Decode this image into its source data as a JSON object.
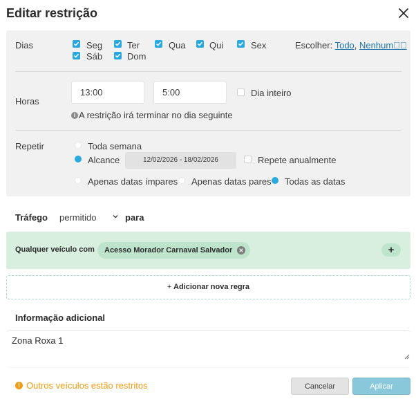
{
  "dialog": {
    "title": "Editar restrição",
    "close_icon": "close-icon"
  },
  "days": {
    "label": "Dias",
    "items": [
      {
        "label": "Seg",
        "checked": true
      },
      {
        "label": "Ter",
        "checked": true
      },
      {
        "label": "Qua",
        "checked": true
      },
      {
        "label": "Qui",
        "checked": true
      },
      {
        "label": "Sex",
        "checked": true
      },
      {
        "label": "Sáb",
        "checked": true
      },
      {
        "label": "Dom",
        "checked": true
      }
    ],
    "choose_label": "Escolher:",
    "choose_all": "Todo",
    "choose_sep": ",",
    "choose_none": "Nenhum",
    "choose_trailing": "⃞⃞"
  },
  "hours": {
    "label": "Horas",
    "start": "13:00",
    "end": "5:00",
    "all_day_label": "Dia inteiro",
    "all_day_checked": false,
    "info_icon": "info-icon",
    "info_text": "A restrição irá terminar no dia seguinte"
  },
  "repeat": {
    "label": "Repetir",
    "options": {
      "whole_week": "Toda semana",
      "range": "Alcance"
    },
    "selected": "Alcance",
    "date_range": "12/02/2026 - 18/02/2026",
    "annually_label": "Repete anualmente",
    "annually_checked": false,
    "date_filter": {
      "odd": "Apenas datas ímpares",
      "even": "Apenas datas pares",
      "all": "Todas as datas",
      "selected": "Todas as datas"
    }
  },
  "traffic": {
    "label": "Tráfego",
    "value": "permitido",
    "para": "para"
  },
  "rule": {
    "label": "Qualquer veículo com",
    "chip": "Acesso Morador Carnaval Salvador",
    "add_icon": "+"
  },
  "add_rule": {
    "plus": "+",
    "label": "Adicionar nova regra"
  },
  "additional_info": {
    "title": "Informação adicional",
    "value": "Zona Roxa 1"
  },
  "footer": {
    "warning_icon": "!",
    "warning": "Outros veículos estão restritos",
    "cancel": "Cancelar",
    "apply": "Aplicar"
  },
  "colors": {
    "accent": "#29a9e0",
    "rule_bg": "#d8efe0",
    "chip_bg": "#bfe4cc",
    "warning": "#f39c12",
    "apply_bg": "#88c8da"
  }
}
